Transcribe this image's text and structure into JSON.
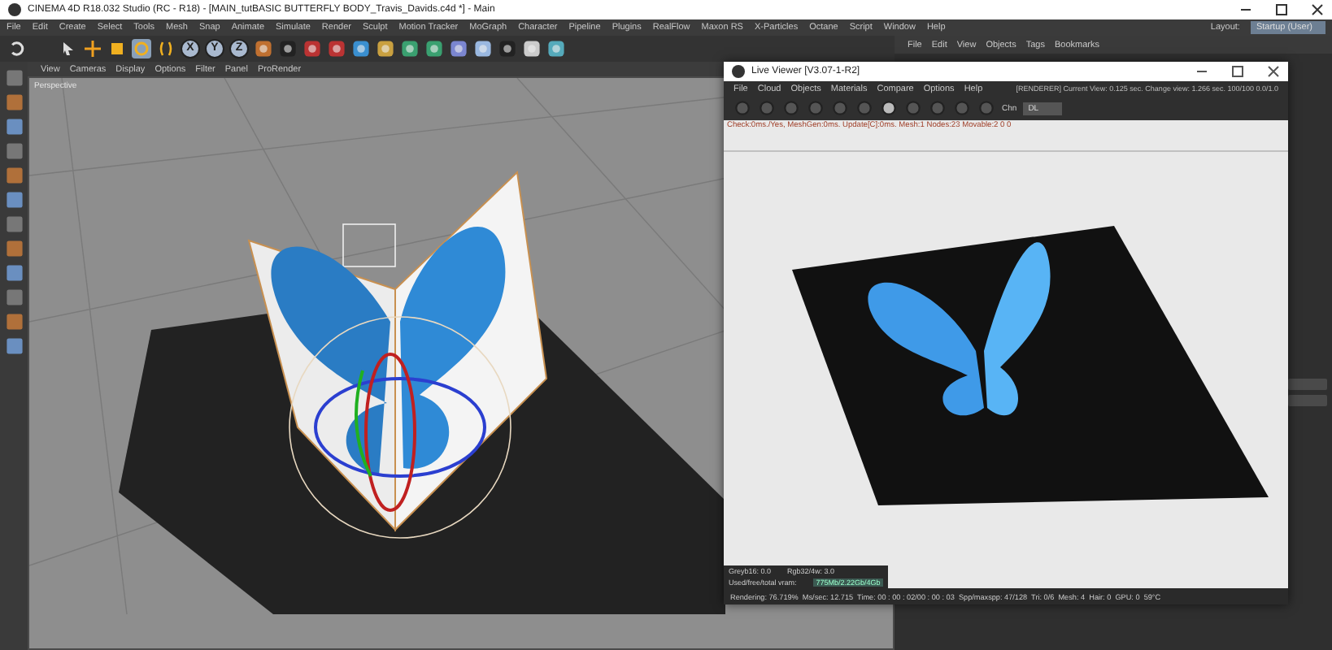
{
  "window": {
    "title": "CINEMA 4D R18.032 Studio (RC - R18) - [MAIN_tutBASIC BUTTERFLY BODY_Travis_Davids.c4d *] - Main"
  },
  "menu": [
    "File",
    "Edit",
    "Create",
    "Select",
    "Tools",
    "Mesh",
    "Snap",
    "Animate",
    "Simulate",
    "Render",
    "Sculpt",
    "Motion Tracker",
    "MoGraph",
    "Character",
    "Pipeline",
    "Plugins",
    "RealFlow",
    "Maxon RS",
    "X-Particles",
    "Octane",
    "Script",
    "Window",
    "Help"
  ],
  "layout": {
    "label": "Layout:",
    "value": "Startup (User)"
  },
  "toolbar": {
    "axis_buttons": [
      {
        "label": "X",
        "on": true
      },
      {
        "label": "Y",
        "on": true
      },
      {
        "label": "Z",
        "on": true
      }
    ]
  },
  "viewport": {
    "menu": [
      "View",
      "Cameras",
      "Display",
      "Options",
      "Filter",
      "Panel",
      "ProRender"
    ],
    "camera": "Perspective"
  },
  "object_manager": {
    "menu": [
      "File",
      "Edit",
      "View",
      "Objects",
      "Tags",
      "Bookmarks"
    ]
  },
  "live_viewer": {
    "title": "Live Viewer [V3.07-1-R2]",
    "menu": [
      "File",
      "Cloud",
      "Objects",
      "Materials",
      "Compare",
      "Options",
      "Help"
    ],
    "info": "[RENDERER] Current View: 0.125 sec. Change view: 1.266 sec. 100/100 0.0/1.0",
    "channel_label": "Chn",
    "channel_value": "DL",
    "status": "Check:0ms./Yes, MeshGen:0ms. Update[C]:0ms. Mesh:1 Nodes:23 Movable:2 0 0",
    "overlay": [
      [
        "Greyb16: 0.0",
        "Rgb32/4w: 3.0"
      ],
      [
        "Used/free/total vram:",
        "775Mb/2.22Gb/4Gb"
      ]
    ],
    "footer": "Rendering: 76.719%  Ms/sec: 12.715  Time: 00 : 00 : 02/00 : 00 : 03  Spp/maxspp: 47/128  Tri: 0/6  Mesh: 4  Hair: 0  GPU: 0  59°C"
  }
}
